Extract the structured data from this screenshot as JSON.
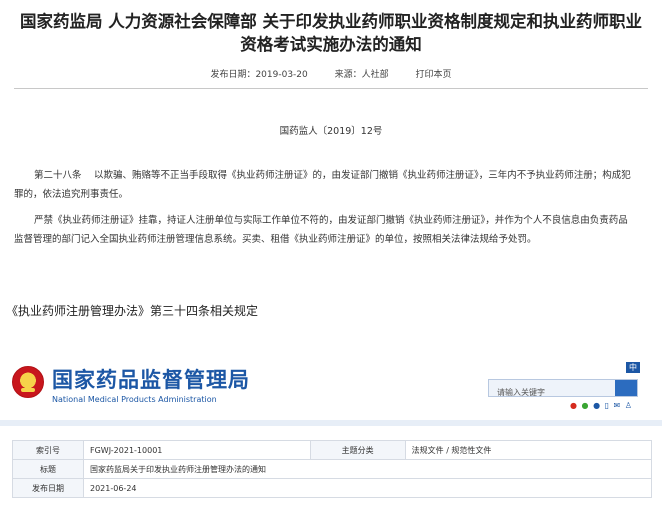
{
  "article": {
    "title": "国家药监局 人力资源社会保障部 关于印发执业药师职业资格制度规定和执业药师职业资格考试实施办法的通知",
    "publish_date": "发布日期：2019-03-20",
    "source": "来源：人社部",
    "print_label": "打印本页",
    "doc_number": "国药监人〔2019〕12号",
    "paragraph1": "第二十八条　 以欺骗、贿赂等不正当手段取得《执业药师注册证》的，由发证部门撤销《执业药师注册证》，三年内不予执业药师注册；构成犯罪的，依法追究刑事责任。",
    "paragraph2": "严禁《执业药师注册证》挂靠，持证人注册单位与实际工作单位不符的，由发证部门撤销《执业药师注册证》，并作为个人不良信息由负责药品监督管理的部门记入全国执业药师注册管理信息系统。买卖、租借《执业药师注册证》的单位，按照相关法律法规给予处罚。"
  },
  "caption": "《执业药师注册管理办法》第三十四条相关规定",
  "site": {
    "name_cn": "国家药品监督管理局",
    "name_en": "National Medical Products Administration",
    "lang_button": "中",
    "search_placeholder": "请输入关键字",
    "icons": [
      "weibo-icon",
      "wechat-icon",
      "user-icon",
      "mobile-icon",
      "mail-icon",
      "person-icon"
    ]
  },
  "info_table": {
    "rows": [
      {
        "label": "索引号",
        "value": "FGWJ-2021-10001",
        "label2": "主题分类",
        "value2": "法规文件 / 规范性文件"
      },
      {
        "label": "标题",
        "value": "国家药监局关于印发执业药师注册管理办法的通知"
      },
      {
        "label": "发布日期",
        "value": "2021-06-24"
      }
    ]
  }
}
